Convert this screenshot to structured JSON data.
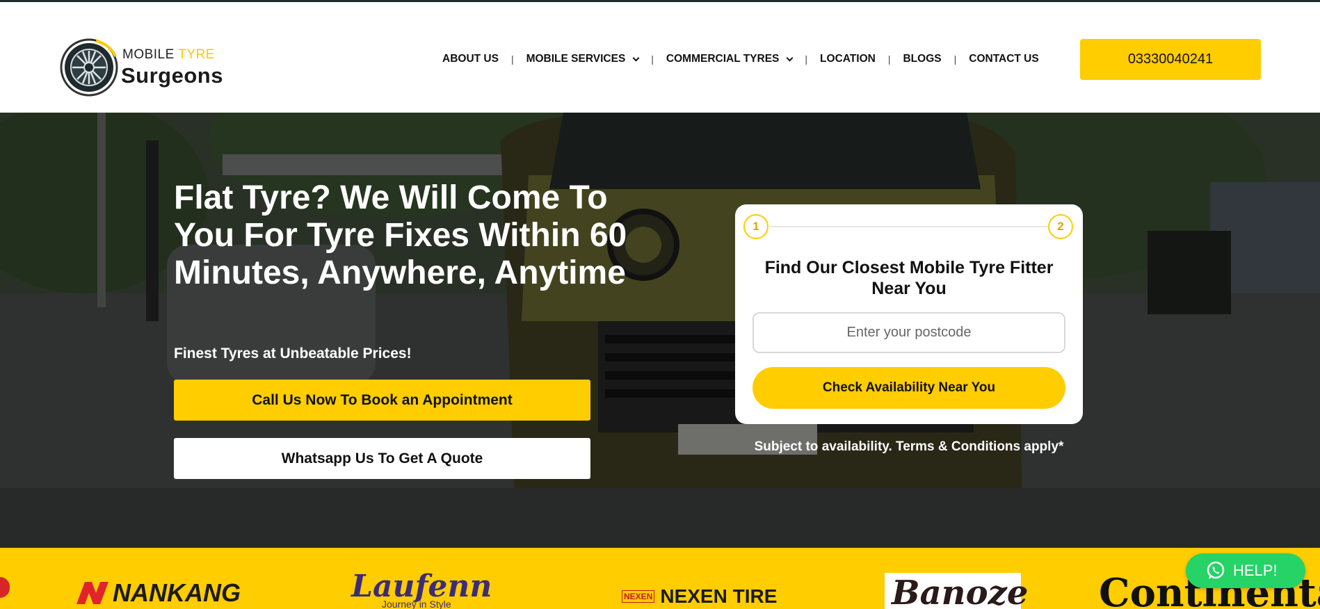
{
  "header": {
    "logo": {
      "line1_a": "MOBILE",
      "line1_b": "TYRE",
      "line2": "Surgeons"
    },
    "nav": [
      {
        "label": "ABOUT US"
      },
      {
        "label": "MOBILE SERVICES"
      },
      {
        "label": "COMMERCIAL TYRES"
      },
      {
        "label": "LOCATION"
      },
      {
        "label": "BLOGS"
      },
      {
        "label": "CONTACT US"
      }
    ],
    "phone": "03330040241"
  },
  "hero": {
    "title": "Flat Tyre? We Will Come To You For Tyre Fixes Within 60 Minutes, Anywhere, Anytime",
    "subtitle": "Finest Tyres at Unbeatable Prices!",
    "call_button": "Call Us Now To Book an Appointment",
    "whatsapp_button": "Whatsapp Us To Get A Quote"
  },
  "finder": {
    "step1": "1",
    "step2": "2",
    "title": "Find Our Closest Mobile Tyre Fitter Near You",
    "postcode_placeholder": "Enter your postcode",
    "postcode_value": "",
    "check_button": "Check Availability Near You",
    "terms": "Subject to availability. Terms & Conditions apply*"
  },
  "brands": {
    "nankang": "NANKANG",
    "laufenn": "Laufenn",
    "laufenn_tagline": "Journey in Style",
    "nexen_mark": "NEXEN",
    "nexen": "NEXEN TIRE",
    "banoze": "Banoze",
    "continental": "Continental"
  },
  "help": {
    "label": "HELP!"
  },
  "colors": {
    "accent": "#ffcd00",
    "whatsapp": "#25d366",
    "dark": "#111111"
  }
}
